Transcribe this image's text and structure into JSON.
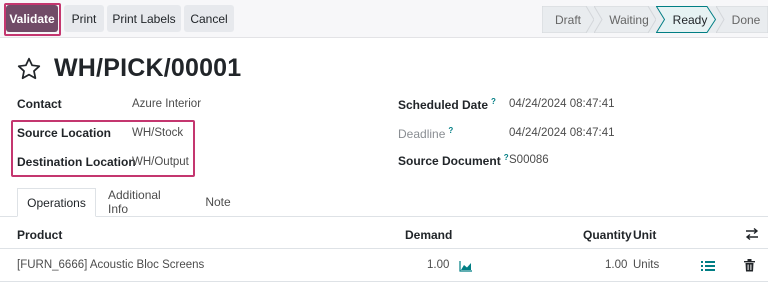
{
  "toolbar": {
    "validate_label": "Validate",
    "print_label": "Print",
    "print_labels_label": "Print Labels",
    "cancel_label": "Cancel"
  },
  "statusbar": {
    "stages": [
      "Draft",
      "Waiting",
      "Ready",
      "Done"
    ],
    "current": "Ready"
  },
  "record": {
    "title": "WH/PICK/00001",
    "favorite": false
  },
  "fields": {
    "contact": {
      "label": "Contact",
      "value": "Azure Interior"
    },
    "source_location": {
      "label": "Source Location",
      "value": "WH/Stock"
    },
    "destination_location": {
      "label": "Destination Location",
      "value": "WH/Output"
    },
    "scheduled_date": {
      "label": "Scheduled Date",
      "tip": "?",
      "value": "04/24/2024 08:47:41"
    },
    "deadline": {
      "label": "Deadline",
      "tip": "?",
      "value": "04/24/2024 08:47:41"
    },
    "source_document": {
      "label": "Source Document",
      "tip": "?",
      "value": "S00086"
    }
  },
  "tabs": [
    {
      "label": "Operations",
      "active": true
    },
    {
      "label": "Additional Info",
      "active": false
    },
    {
      "label": "Note",
      "active": false
    }
  ],
  "operations": {
    "columns": {
      "product": "Product",
      "demand": "Demand",
      "quantity": "Quantity",
      "unit": "Unit"
    },
    "rows": [
      {
        "product": "[FURN_6666] Acoustic Bloc Screens",
        "demand": "1.00",
        "quantity": "1.00",
        "unit": "Units"
      }
    ]
  },
  "colors": {
    "primary": "#714b67",
    "highlight": "#c4366f",
    "accent": "#017e84",
    "active_stage_bg": "#e6f2f3"
  }
}
